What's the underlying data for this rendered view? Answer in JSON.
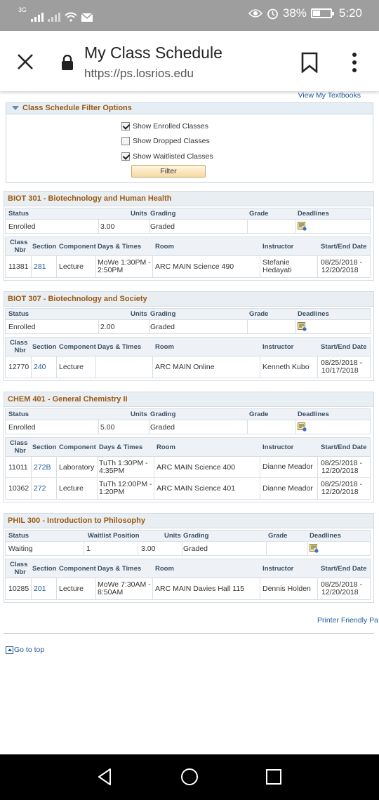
{
  "status_bar": {
    "network": "3G",
    "battery_percent": "38%",
    "battery_level": 0.38,
    "time": "5:20",
    "icons": [
      "signal-icon",
      "signal-secondary-icon",
      "wifi-icon",
      "mail-icon",
      "eye-icon",
      "alarm-icon",
      "battery-icon"
    ]
  },
  "browser": {
    "title": "My Class Schedule",
    "url": "https://ps.losrios.edu",
    "icons": [
      "close-icon",
      "lock-icon",
      "bookmark-icon",
      "more-vert-icon"
    ]
  },
  "page": {
    "textbooks_link": "View My Textbooks",
    "filter": {
      "header": "Class Schedule Filter Options",
      "options": [
        {
          "label": "Show Enrolled Classes",
          "checked": true
        },
        {
          "label": "Show Dropped Classes",
          "checked": false
        },
        {
          "label": "Show Waitlisted Classes",
          "checked": true
        }
      ],
      "button": "Filter"
    },
    "status_headers": {
      "status": "Status",
      "waitlist_position": "Waitlist Position",
      "units": "Units",
      "grading": "Grading",
      "grade": "Grade",
      "deadlines": "Deadlines"
    },
    "class_headers": {
      "class_nbr_line1": "Class",
      "class_nbr_line2": "Nbr",
      "section": "Section",
      "component": "Component",
      "days_times": "Days & Times",
      "room": "Room",
      "instructor": "Instructor",
      "start_end": "Start/End Date"
    },
    "courses": [
      {
        "title": "BIOT 301 - Biotechnology and Human Health",
        "status": "Enrolled",
        "units": "3.00",
        "grading": "Graded",
        "grade": "",
        "classes": [
          {
            "nbr": "11381",
            "section": "281",
            "component": "Lecture",
            "days_times_1": "MoWe 1:30PM -",
            "days_times_2": "2:50PM",
            "room": "ARC MAIN Science 490",
            "instructor_1": "Stefanie",
            "instructor_2": "Hedayati",
            "dates_1": "08/25/2018 -",
            "dates_2": "12/20/2018"
          }
        ]
      },
      {
        "title": "BIOT 307 - Biotechnology and Society",
        "status": "Enrolled",
        "units": "2.00",
        "grading": "Graded",
        "grade": "",
        "classes": [
          {
            "nbr": "12770",
            "section": "240",
            "component": "Lecture",
            "days_times_1": "",
            "days_times_2": "",
            "room": "ARC MAIN Online",
            "instructor_1": "Kenneth Kubo",
            "instructor_2": "",
            "dates_1": "08/25/2018 -",
            "dates_2": "10/17/2018"
          }
        ]
      },
      {
        "title": "CHEM 401 - General Chemistry II",
        "status": "Enrolled",
        "units": "5.00",
        "grading": "Graded",
        "grade": "",
        "classes": [
          {
            "nbr": "11011",
            "section": "272B",
            "component": "Laboratory",
            "days_times_1": "TuTh 1:30PM -",
            "days_times_2": "4:35PM",
            "room": "ARC MAIN Science 400",
            "instructor_1": "Dianne Meador",
            "instructor_2": "",
            "dates_1": "08/25/2018 -",
            "dates_2": "12/20/2018"
          },
          {
            "nbr": "10362",
            "section": "272",
            "component": "Lecture",
            "days_times_1": "TuTh 12:00PM -",
            "days_times_2": "1:20PM",
            "room": "ARC MAIN Science 401",
            "instructor_1": "Dianne Meador",
            "instructor_2": "",
            "dates_1": "08/25/2018 -",
            "dates_2": "12/20/2018"
          }
        ]
      },
      {
        "title": "PHIL 300 - Introduction to Philosophy",
        "status": "Waiting",
        "waitlist_position": "1",
        "units": "3.00",
        "grading": "Graded",
        "grade": "",
        "classes": [
          {
            "nbr": "10285",
            "section": "201",
            "component": "Lecture",
            "days_times_1": "MoWe 7:30AM -",
            "days_times_2": "8:50AM",
            "room": "ARC MAIN Davies Hall 115",
            "instructor_1": "Dennis Holden",
            "instructor_2": "",
            "dates_1": "08/25/2018 -",
            "dates_2": "12/20/2018"
          }
        ]
      }
    ],
    "printer_link": "Printer Friendly Pa",
    "go_top": "Go to top"
  },
  "nav_bar": {
    "icons": [
      "back-icon",
      "home-icon",
      "recent-apps-icon"
    ]
  }
}
